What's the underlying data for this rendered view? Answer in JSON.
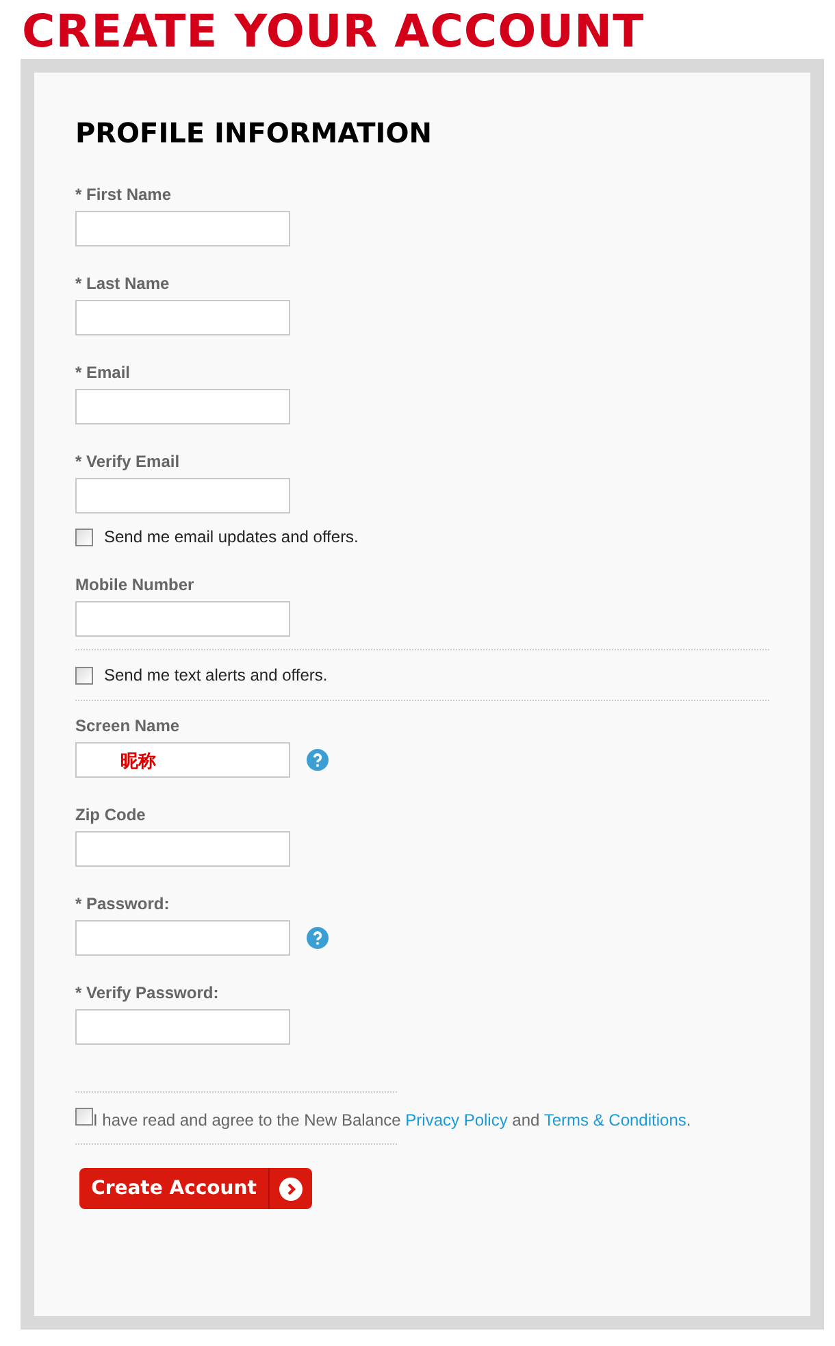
{
  "title": "CREATE YOUR ACCOUNT",
  "section_title": "PROFILE INFORMATION",
  "items": [
    {
      "kind": "field",
      "label": "* First Name",
      "help": false
    },
    {
      "kind": "field",
      "label": "* Last Name",
      "help": false
    },
    {
      "kind": "field",
      "label": "* Email",
      "help": false
    },
    {
      "kind": "field",
      "label": "* Verify Email",
      "help": false
    },
    {
      "kind": "checkbox",
      "label": "Send me email updates and offers.",
      "checked": false,
      "ruled": false
    },
    {
      "kind": "field",
      "label": "Mobile Number",
      "help": false
    },
    {
      "kind": "checkbox",
      "label": "Send me text alerts and offers.",
      "checked": false,
      "ruled": true
    },
    {
      "kind": "field",
      "label": "Screen Name",
      "value": "昵称",
      "help": true
    },
    {
      "kind": "field",
      "label": "Zip Code",
      "help": false
    },
    {
      "kind": "field",
      "label": "* Password:",
      "help": true
    },
    {
      "kind": "field",
      "label": "* Verify Password:",
      "help": false
    }
  ],
  "agreement": {
    "checked": false,
    "parts": [
      {
        "kind": "text",
        "text": "I have read and agree to the New Balance "
      },
      {
        "kind": "link",
        "text": "Privacy Policy"
      },
      {
        "kind": "text",
        "text": " and "
      },
      {
        "kind": "link",
        "text": "Terms & Conditions"
      },
      {
        "kind": "text",
        "text": "."
      }
    ]
  },
  "submit": {
    "label": "Create Account"
  }
}
